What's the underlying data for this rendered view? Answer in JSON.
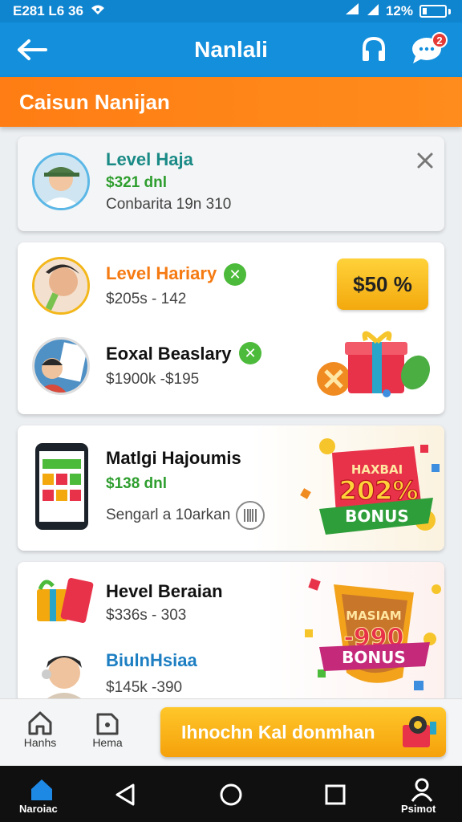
{
  "status_bar": {
    "time": "E281 L6 36",
    "battery": "12%"
  },
  "app_bar": {
    "title": "Nanlali",
    "chat_badge": "2"
  },
  "banner": {
    "title": "Caisun Nanijan"
  },
  "cards": {
    "c1": {
      "title": "Level Haja",
      "amount": "$321 dnl",
      "sub": "Conbarita 19n 310"
    },
    "c2a": {
      "title": "Level Hariary",
      "sub": "$205s - 142"
    },
    "c2_chip": "$50 %",
    "c2b": {
      "title": "Eoxal Beaslary",
      "sub": "$1900k -$195"
    },
    "c3": {
      "title": "Matlgi Hajoumis",
      "amount": "$138 dnl",
      "sub": "Sengarl a 10arkan"
    },
    "c3_bonus": {
      "top": "HAXBAI",
      "pct": "202%",
      "word": "BONUS"
    },
    "c4a": {
      "title": "Hevel Beraian",
      "sub": "$336s - 303"
    },
    "c4b": {
      "title": "BiulnHsiaa",
      "sub": "$145k -390"
    },
    "c4_bonus": {
      "top": "MASIAM",
      "pct": "-990",
      "word": "BONUS"
    }
  },
  "bottom_bar": {
    "tab_home": "Hanhs",
    "tab_hema": "Hema",
    "cta": "Ihnochn Kal donmhan"
  },
  "system_nav": {
    "left_label": "Naroiac",
    "right_label": "Psimot"
  },
  "colors": {
    "primary": "#138fdc",
    "banner": "#ff7d14",
    "cta": "#f5a10b",
    "success": "#4cba3a"
  }
}
